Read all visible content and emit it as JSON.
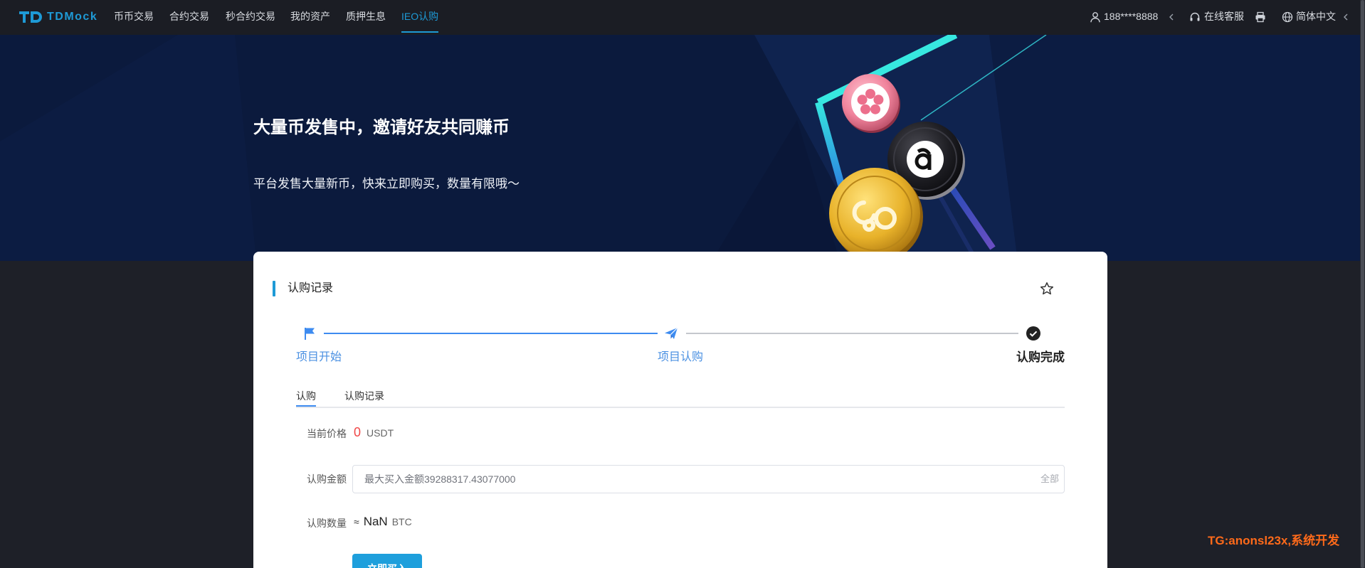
{
  "app": {
    "logo_text": "TDMock"
  },
  "nav": {
    "items": [
      {
        "label": "币币交易",
        "active": false
      },
      {
        "label": "合约交易",
        "active": false
      },
      {
        "label": "秒合约交易",
        "active": false
      },
      {
        "label": "我的资产",
        "active": false
      },
      {
        "label": "质押生息",
        "active": false
      },
      {
        "label": "IEO认购",
        "active": true
      }
    ],
    "user_phone": "188****8888",
    "support_label": "在线客服",
    "language_label": "简体中文"
  },
  "banner": {
    "title": "大量币发售中，邀请好友共同赚币",
    "subtitle": "平台发售大量新币，快来立即购买，数量有限哦～"
  },
  "card": {
    "title": "认购记录",
    "steps": [
      {
        "label": "项目开始",
        "reached": true
      },
      {
        "label": "项目认购",
        "reached": true
      },
      {
        "label": "认购完成",
        "reached": false
      }
    ],
    "tabs": [
      {
        "label": "认购",
        "active": true
      },
      {
        "label": "认购记录",
        "active": false
      }
    ],
    "form": {
      "price_label": "当前价格",
      "price_value": "0",
      "price_unit": "USDT",
      "amount_label": "认购金额",
      "amount_placeholder": "最大买入金额39288317.43077000",
      "all_label": "全部",
      "quantity_label": "认购数量",
      "quantity_approx": "≈",
      "quantity_value": "NaN",
      "quantity_unit": "BTC",
      "submit_label": "立即买入"
    }
  },
  "watermark": "TG:anonsl23x,系统开发",
  "icons": [
    "logo-icon",
    "user-icon",
    "chevron-left-icon",
    "headset-icon",
    "printer-icon",
    "globe-icon",
    "star-icon",
    "flag-icon",
    "paper-plane-icon",
    "check-circle-icon"
  ],
  "colors": {
    "accent": "#1e9ad6",
    "step_active": "#3d8bf0",
    "price": "#f04747",
    "watermark": "#ff6a1a",
    "nav_bg": "#1b1d24",
    "banner_bg": "#0b1a3d",
    "page_bg": "#1e2028"
  }
}
